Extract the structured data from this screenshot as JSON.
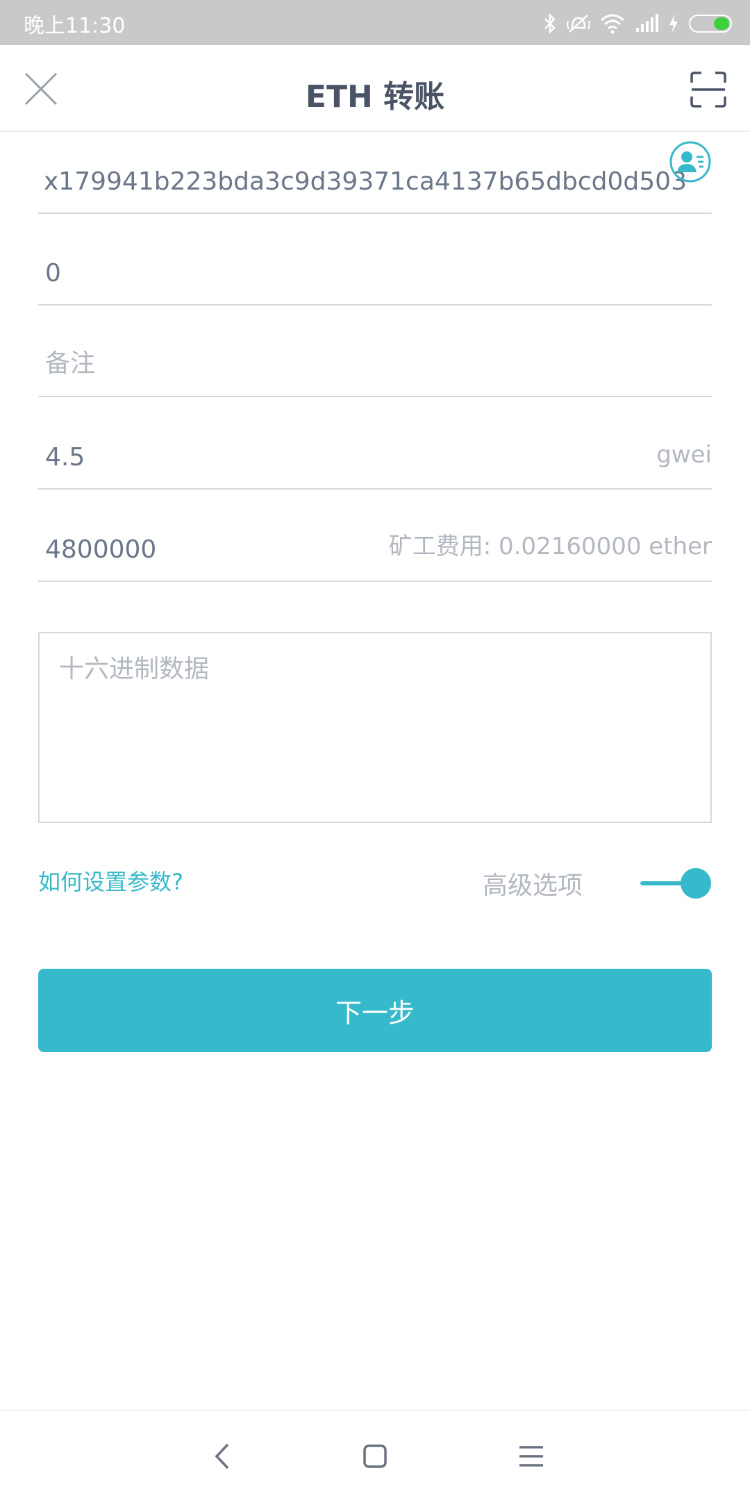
{
  "status_bar": {
    "time": "晚上11:30",
    "icons": [
      "bluetooth-icon",
      "mute-icon",
      "wifi-icon",
      "signal-icon",
      "charging-icon",
      "battery-icon"
    ],
    "battery_color": "#3fd13b"
  },
  "header": {
    "title": "ETH 转账",
    "close_icon": "close-icon",
    "scan_icon": "scan-icon"
  },
  "form": {
    "address_value": "x179941b223bda3c9d39371ca4137b65dbcd0d503",
    "contact_icon": "contact-book-icon",
    "amount_value": "0",
    "memo_placeholder": "备注",
    "gas_price_value": "4.5",
    "gas_price_unit": "gwei",
    "gas_limit_value": "4800000",
    "miner_fee_text": "矿工费用: 0.02160000 ether",
    "hex_data_placeholder": "十六进制数据"
  },
  "options": {
    "help_link": "如何设置参数?",
    "advanced_label": "高级选项",
    "advanced_enabled": true
  },
  "actions": {
    "next_label": "下一步"
  },
  "theme": {
    "accent": "#36b9ca",
    "title_color": "#4a5466",
    "placeholder_color": "#b3b8c0"
  },
  "nav_bar": {
    "icons": [
      "back-icon",
      "home-icon",
      "menu-icon"
    ]
  }
}
